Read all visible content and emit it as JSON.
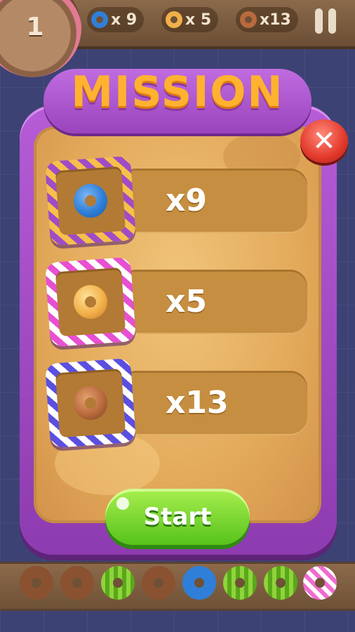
{
  "hud": {
    "level": "1",
    "counters": [
      {
        "icon": "blue-donut-icon",
        "count": "x 9"
      },
      {
        "icon": "glazed-donut-icon",
        "count": "x 5"
      },
      {
        "icon": "sprinkle-donut-icon",
        "count": "x13"
      }
    ]
  },
  "dialog": {
    "title": "MISSION",
    "close_label": "✕",
    "start_label": "Start"
  },
  "missions": [
    {
      "icon": "blue-donut-icon",
      "count": "x9"
    },
    {
      "icon": "glazed-donut-icon",
      "count": "x5"
    },
    {
      "icon": "sprinkle-donut-icon",
      "count": "x13"
    }
  ],
  "colors": {
    "dialog_frame": "#a04cc6",
    "title_text": "#ffb230",
    "start_button": "#6fd428",
    "close_button": "#e2392b",
    "blue_donut": "#2f7fd8",
    "glazed_donut": "#f2b04a",
    "sprinkle_donut": "#b86a3c",
    "tile_yellow_stripe": "#f6c04a",
    "tile_pink_stripe": "#e84fd2",
    "tile_blue_stripe": "#5b4fe0"
  },
  "tray": {
    "items": [
      "choco-donut-icon",
      "choco-donut-icon",
      "green-donut-icon",
      "choco-donut-icon",
      "blue-donut-icon",
      "green-donut-icon",
      "green-donut-icon",
      "pink-donut-icon"
    ]
  }
}
